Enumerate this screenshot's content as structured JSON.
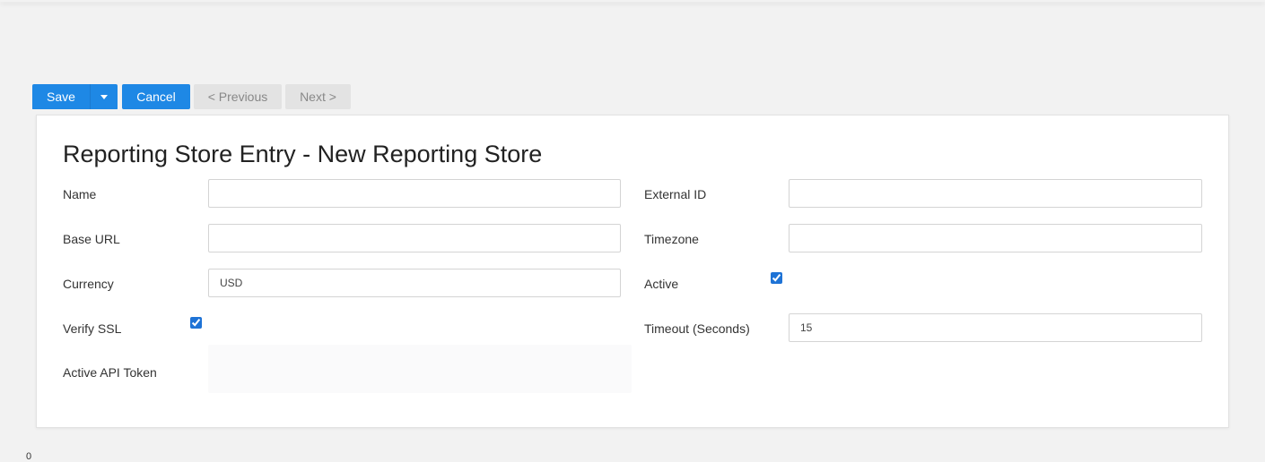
{
  "toolbar": {
    "save_label": "Save",
    "cancel_label": "Cancel",
    "previous_label": "< Previous",
    "next_label": "Next >"
  },
  "colors": {
    "primary": "#1e88e5",
    "disabled_bg": "#e3e3e3",
    "page_bg": "#f2f2f2"
  },
  "form": {
    "title": "Reporting Store Entry - New Reporting Store",
    "name": {
      "label": "Name",
      "value": ""
    },
    "external_id": {
      "label": "External ID",
      "value": ""
    },
    "base_url": {
      "label": "Base URL",
      "value": ""
    },
    "timezone": {
      "label": "Timezone",
      "value": ""
    },
    "currency": {
      "label": "Currency",
      "value": "USD"
    },
    "active": {
      "label": "Active",
      "checked": true
    },
    "verify_ssl": {
      "label": "Verify SSL",
      "checked": true
    },
    "timeout": {
      "label": "Timeout (Seconds)",
      "value": "15"
    },
    "api_token": {
      "label": "Active API Token"
    }
  },
  "footer": {
    "stray_char": "0"
  }
}
